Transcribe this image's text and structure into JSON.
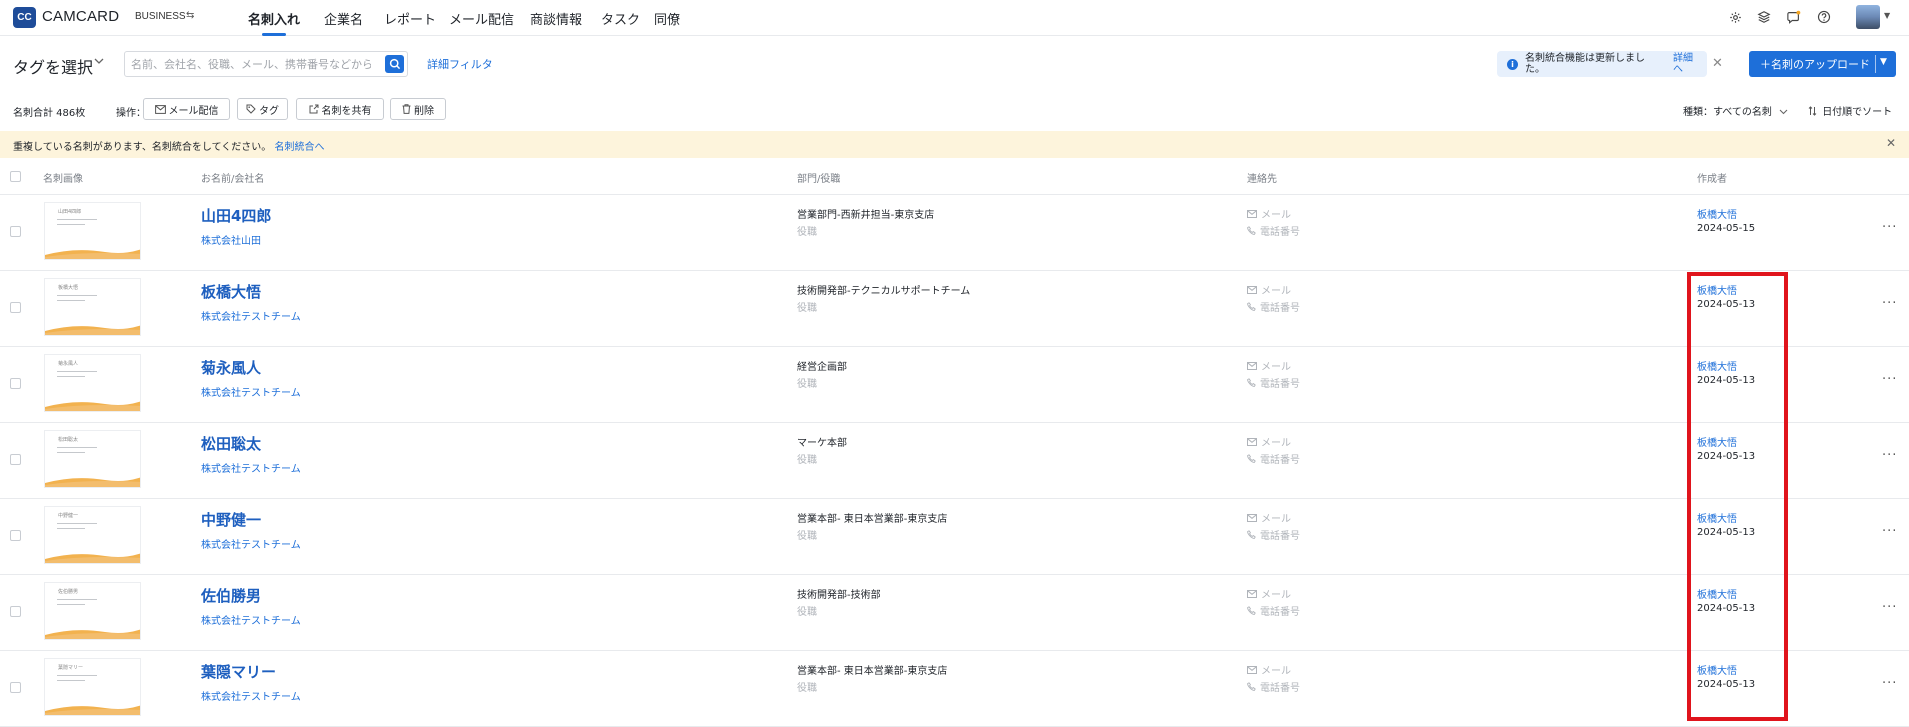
{
  "app": {
    "logo_mark": "CC",
    "logo_text": "CAMCARD",
    "edition": "BUSINESS",
    "edition_switch_icon": "swap-icon"
  },
  "nav": {
    "tabs": [
      {
        "label": "名刺入れ",
        "active": true
      },
      {
        "label": "企業名",
        "active": false
      },
      {
        "label": "レポート",
        "active": false
      },
      {
        "label": "メール配信",
        "active": false
      },
      {
        "label": "商談情報",
        "active": false
      },
      {
        "label": "タスク",
        "active": false
      },
      {
        "label": "同僚",
        "active": false
      }
    ],
    "icons": [
      "settings-icon",
      "layers-icon",
      "chat-notification-icon",
      "help-icon"
    ]
  },
  "filters": {
    "tag_select": "タグを選択",
    "search_placeholder": "名前、会社名、役職、メール、携帯番号などから検索",
    "advanced_filter": "詳細フィルタ"
  },
  "notice": {
    "text": "名刺統合機能は更新しました。",
    "link": "詳細へ"
  },
  "upload_button": "＋名刺のアップロード",
  "toolbar": {
    "total": "名刺合計 486枚",
    "ops_label": "操作：",
    "buttons": [
      {
        "label": "メール配信",
        "icon": "mail-icon"
      },
      {
        "label": "タグ",
        "icon": "tag-icon"
      },
      {
        "label": "名刺を共有",
        "icon": "share-icon"
      },
      {
        "label": "削除",
        "icon": "trash-icon"
      }
    ],
    "kind_filter": "種類：すべての名刺",
    "sort": "日付順でソート"
  },
  "banner": {
    "text": "重複している名刺があります、名刺統合をしてください。",
    "link": "名刺統合へ"
  },
  "table": {
    "headers": {
      "image": "名刺画像",
      "name": "お名前/会社名",
      "dept": "部門/役職",
      "contact": "連絡先",
      "creator": "作成者"
    },
    "contact_email_placeholder": "メール",
    "contact_phone_placeholder": "電話番号",
    "role_placeholder": "役職",
    "rows": [
      {
        "name": "山田4四郎",
        "company": "株式会社山田",
        "dept": "営業部門-西新井担当-東京支店",
        "creator": "板橋大悟",
        "created": "2024-05-15"
      },
      {
        "name": "板橋大悟",
        "company": "株式会社テストチーム",
        "dept": "技術開発部-テクニカルサポートチーム",
        "creator": "板橋大悟",
        "created": "2024-05-13"
      },
      {
        "name": "菊永風人",
        "company": "株式会社テストチーム",
        "dept": "経営企画部",
        "creator": "板橋大悟",
        "created": "2024-05-13"
      },
      {
        "name": "松田聡太",
        "company": "株式会社テストチーム",
        "dept": "マーケ本部",
        "creator": "板橋大悟",
        "created": "2024-05-13"
      },
      {
        "name": "中野健一",
        "company": "株式会社テストチーム",
        "dept": "営業本部- 東日本営業部-東京支店",
        "creator": "板橋大悟",
        "created": "2024-05-13"
      },
      {
        "name": "佐伯勝男",
        "company": "株式会社テストチーム",
        "dept": "技術開発部-技術部",
        "creator": "板橋大悟",
        "created": "2024-05-13"
      },
      {
        "name": "葉隠マリー",
        "company": "株式会社テストチーム",
        "dept": "営業本部- 東日本営業部-東京支店",
        "creator": "板橋大悟",
        "created": "2024-05-13"
      }
    ]
  },
  "colors": {
    "accent": "#1e6fd9",
    "banner_bg": "#fdf4dc",
    "highlight": "#e0141c",
    "card_wave": "#f0a530"
  }
}
